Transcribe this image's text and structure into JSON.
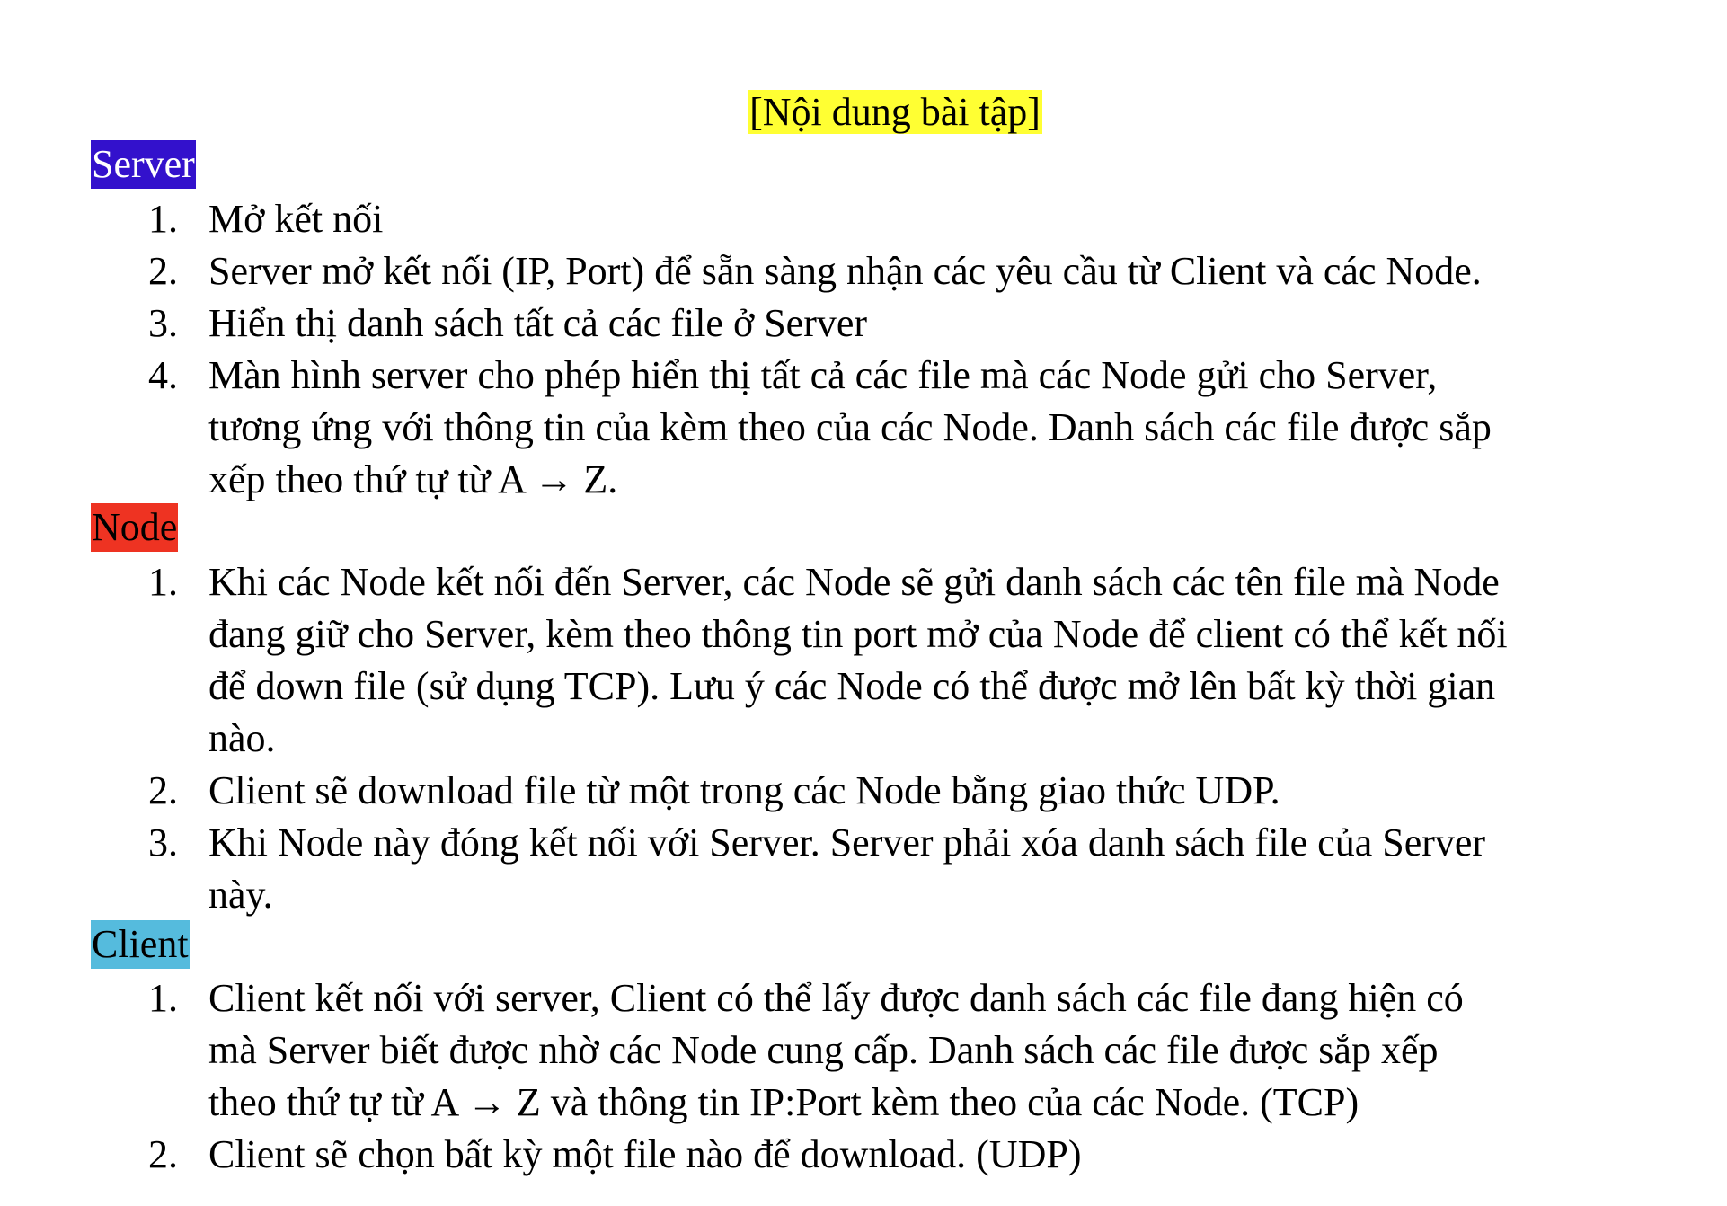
{
  "title": "[Nội dung bài tập]",
  "sections": {
    "server": {
      "label": "Server",
      "items": [
        {
          "num": "1.",
          "text": "Mở kết nối"
        },
        {
          "num": "2.",
          "text": "Server mở kết nối (IP, Port) để sẵn sàng nhận các yêu cầu từ Client và các Node."
        },
        {
          "num": "3.",
          "text": "Hiển thị danh sách tất cả các file ở Server"
        },
        {
          "num": "4.",
          "text": "Màn hình server cho phép hiển thị tất cả các file mà các Node gửi cho Server,\ntương ứng với thông tin của kèm theo của các Node. Danh sách các file được sắp\nxếp theo thứ tự từ A → Z."
        }
      ]
    },
    "node": {
      "label": "Node",
      "items": [
        {
          "num": "1.",
          "text": "Khi các Node kết nối đến Server, các Node sẽ gửi danh sách các tên file mà Node\nđang giữ cho Server, kèm theo thông tin port mở của Node để client có thể kết nối\nđể down file (sử dụng TCP). Lưu ý các Node có thể được mở lên bất kỳ thời gian\nnào."
        },
        {
          "num": "2.",
          "text": "Client sẽ download file từ một trong các Node bằng giao thức UDP."
        },
        {
          "num": "3.",
          "text": "Khi Node này đóng kết nối với Server. Server phải xóa danh sách file của Server\nnày."
        }
      ]
    },
    "client": {
      "label": "Client",
      "items": [
        {
          "num": "1.",
          "text": "Client kết nối với server, Client có thể lấy được danh sách các file đang hiện có\nmà Server biết được nhờ các Node cung cấp. Danh sách các file được sắp xếp\ntheo thứ tự từ A → Z và thông tin IP:Port kèm theo của các Node. (TCP)"
        },
        {
          "num": "2.",
          "text": "Client sẽ chọn bất kỳ một file nào để download. (UDP)"
        }
      ]
    }
  },
  "colors": {
    "title_highlight": "#ffff33",
    "server_highlight": "#3311cc",
    "node_highlight": "#ee3322",
    "client_highlight": "#55bbdd"
  }
}
